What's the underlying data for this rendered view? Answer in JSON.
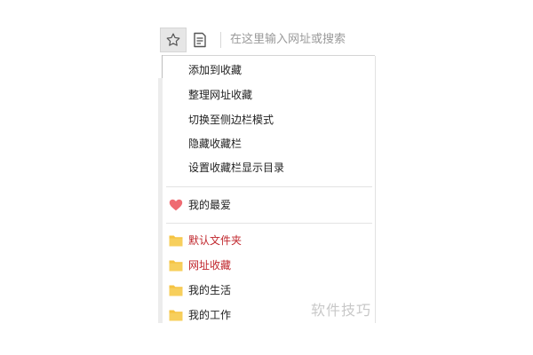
{
  "toolbar": {
    "favorite_icon": "star-outline-icon",
    "reader_icon": "reader-mode-icon",
    "address_placeholder": "在这里输入网址或搜索"
  },
  "menu": {
    "actions": [
      {
        "label": "添加到收藏"
      },
      {
        "label": "整理网址收藏"
      },
      {
        "label": "切换至侧边栏模式"
      },
      {
        "label": "隐藏收藏栏"
      },
      {
        "label": "设置收藏栏显示目录"
      }
    ],
    "favorites": {
      "label": "我的最爱",
      "icon": "heart-icon",
      "color": "#ef6b72"
    },
    "folders": [
      {
        "label": "默认文件夹",
        "highlight": true,
        "icon": "folder-icon"
      },
      {
        "label": "网址收藏",
        "highlight": true,
        "icon": "folder-icon"
      },
      {
        "label": "我的生活",
        "highlight": false,
        "icon": "folder-icon"
      },
      {
        "label": "我的工作",
        "highlight": false,
        "icon": "folder-icon"
      }
    ],
    "folder_color": "#f5c342",
    "highlight_color": "#c0262c"
  },
  "watermark": {
    "text": "软件技巧"
  }
}
